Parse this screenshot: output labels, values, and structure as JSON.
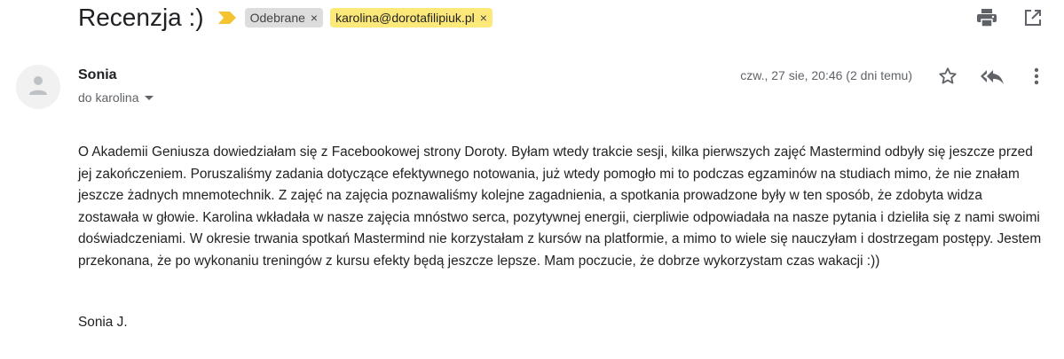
{
  "subject": "Recenzja :)",
  "labels": [
    {
      "text": "Odebrane",
      "remove": "×"
    },
    {
      "text": "karolina@dorotafilipiuk.pl",
      "remove": "×"
    }
  ],
  "sender": {
    "name": "Sonia",
    "recipient": "do karolina"
  },
  "date": "czw., 27 sie, 20:46 (2 dni temu)",
  "body": "O Akademii Geniusza dowiedziałam się z Facebookowej strony Doroty. Byłam wtedy trakcie sesji, kilka pierwszych zajęć Mastermind odbyły się jeszcze przed jej zakończeniem. Poruszaliśmy zadania dotyczące efektywnego notowania, już wtedy pomogło mi to podczas egzaminów na studiach mimo, że nie znałam jeszcze żadnych mnemotechnik. Z zajęć na zajęcia poznawaliśmy kolejne zagadnienia, a spotkania prowadzone były w ten sposób, że zdobyta widza zostawała w głowie. Karolina wkładała w nasze zajęcia mnóstwo serca, pozytywnej energii, cierpliwie odpowiadała na nasze pytania i dzieliła się z nami swoimi doświadczeniami. W okresie trwania spotkań Mastermind nie korzystałam z kursów na platformie, a mimo to wiele się nauczyłam i dostrzegam postępy. Jestem przekonana, że po wykonaniu treningów z kursu efekty będą jeszcze lepsze. Mam poczucie, że dobrze wykorzystam czas wakacji :))",
  "signature": "Sonia J.",
  "icons": {
    "importance": "importance-marker-icon",
    "print": "print-icon",
    "open_new_window": "open-in-new-window-icon",
    "avatar": "person-icon",
    "star": "star-icon",
    "reply_all": "reply-all-icon",
    "more": "more-vertical-icon"
  },
  "colors": {
    "importance": "#f4c430",
    "label_grey": "#dddddd",
    "label_yellow": "#fde87a"
  }
}
